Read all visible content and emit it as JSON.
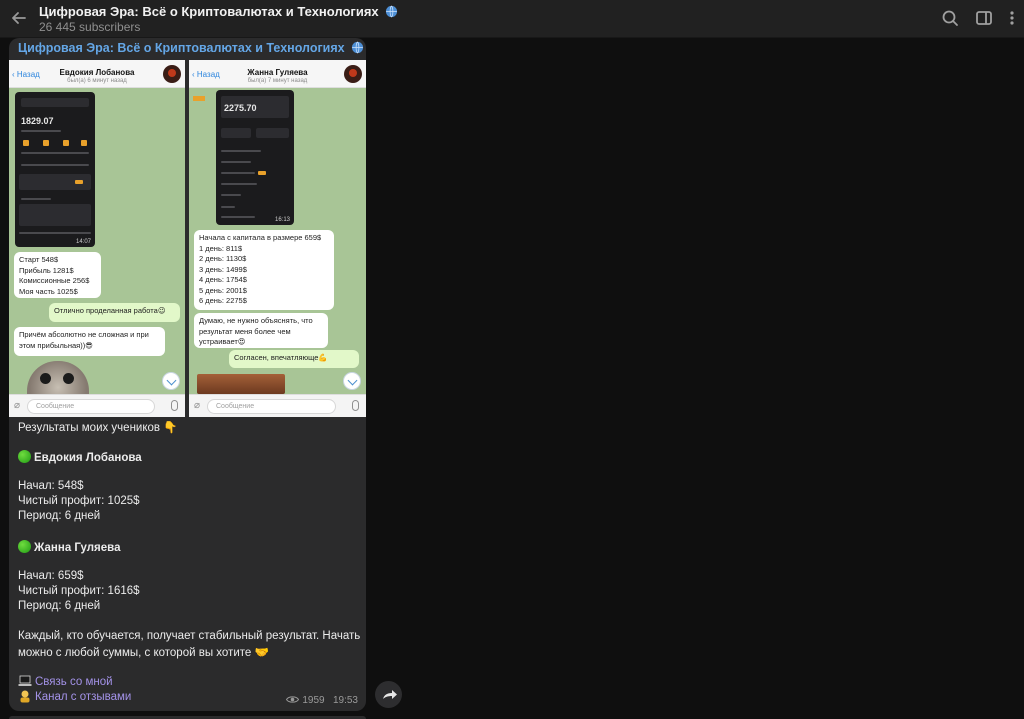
{
  "header": {
    "channel_title": "Цифровая Эра: Всё о Криптовалютах и Технологиях",
    "subscribers": "26 445 subscribers",
    "icons": [
      "back-arrow-icon",
      "search-icon",
      "sidebar-toggle-icon",
      "more-vertical-icon"
    ]
  },
  "message": {
    "author": "Цифровая Эра: Всё о Криптовалютах и Технологиях",
    "screenshots": {
      "left": {
        "back": "Назад",
        "name": "Евдокия Лобанова",
        "seen": "был(а) 6 минут назад",
        "phone_amount": "1829.07",
        "phone_time": "14:07",
        "stats_lines": [
          "Старт 548$",
          "Прибыль 1281$",
          "Комиссионные 256$",
          "Моя часть 1025$"
        ],
        "out_msg": "Отлично проделанная работа😉",
        "in_msg": "Причём абсолютно не сложная и при этом прибыльная))😎",
        "input_placeholder": "Сообщение"
      },
      "right": {
        "back": "Назад",
        "name": "Жанна Гуляева",
        "seen": "был(а) 7 минут назад",
        "phone_amount": "2275.70",
        "phone_time": "16:13",
        "days_lines": [
          "Начала с капитала в размере 659$",
          "1 день: 811$",
          "2 день: 1130$",
          "3 день: 1499$",
          "4 день: 1754$",
          "5 день: 2001$",
          "6 день: 2275$"
        ],
        "in_msg": "Думаю, не нужно объяснять, что результат меня более чем устраивает😍",
        "out_msg": "Согласен, впечатляюще💪",
        "input_placeholder": "Сообщение"
      }
    },
    "lines": {
      "intro": "Результаты моих учеников 👇",
      "student1_name": "Евдокия Лобанова",
      "student1_start": "Начал: 548$",
      "student1_profit": "Чистый профит: 1025$",
      "student1_period": "Период: 6 дней",
      "student2_name": "Жанна Гуляева",
      "student2_start": "Начал: 659$",
      "student2_profit": "Чистый профит: 1616$",
      "student2_period": "Период: 6 дней",
      "closing_1": "Каждый, кто обучается, получает стабильный результат. Начать",
      "closing_2": "можно с любой суммы, с которой вы хотите 🤝",
      "link_contact": "Связь со мной",
      "link_reviews": "Канал с отзывами"
    },
    "views": "1959",
    "time": "19:53"
  },
  "colors": {
    "app_bg": "#0f0f0f",
    "header_bg": "#212121",
    "bubble_bg": "#2b2b2c",
    "author_color": "#64a6e6",
    "link_color": "#a392e8"
  }
}
